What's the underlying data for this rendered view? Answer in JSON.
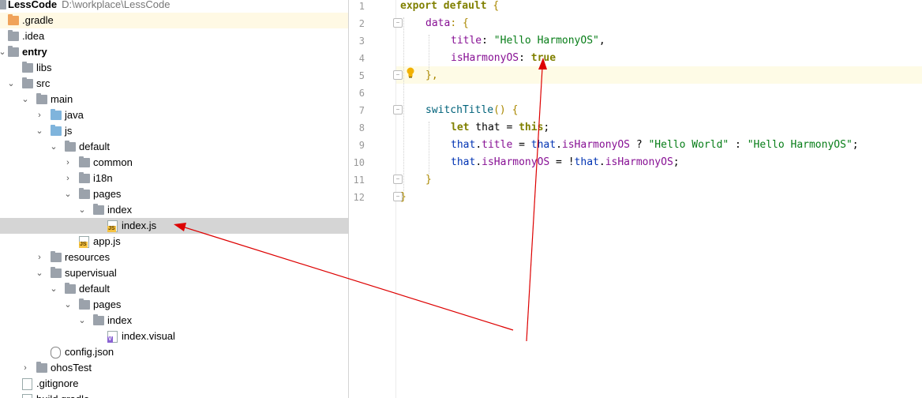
{
  "project": {
    "name": "LessCode",
    "path": "D:\\workplace\\LessCode",
    "items": [
      {
        "label": ".gradle"
      },
      {
        "label": ".idea"
      },
      {
        "label": "entry"
      },
      {
        "label": "libs"
      },
      {
        "label": "src"
      },
      {
        "label": "main"
      },
      {
        "label": "java"
      },
      {
        "label": "js"
      },
      {
        "label": "default"
      },
      {
        "label": "common"
      },
      {
        "label": "i18n"
      },
      {
        "label": "pages"
      },
      {
        "label": "index"
      },
      {
        "label": "index.js"
      },
      {
        "label": "app.js"
      },
      {
        "label": "resources"
      },
      {
        "label": "supervisual"
      },
      {
        "label": "default"
      },
      {
        "label": "pages"
      },
      {
        "label": "index"
      },
      {
        "label": "index.visual"
      },
      {
        "label": "config.json"
      },
      {
        "label": "ohosTest"
      },
      {
        "label": ".gitignore"
      },
      {
        "label": "build.gradle"
      }
    ]
  },
  "editor": {
    "line_numbers": [
      "1",
      "2",
      "3",
      "4",
      "5",
      "6",
      "7",
      "8",
      "9",
      "10",
      "11",
      "12"
    ],
    "code": {
      "l1_kw": "export default",
      "l1_brace": " {",
      "l2_prop": "data",
      "l2_rest": ": {",
      "l3_prop": "title",
      "l3_colon": ": ",
      "l3_str": "\"Hello HarmonyOS\"",
      "l3_comma": ",",
      "l4_prop": "isHarmonyOS",
      "l4_colon": ": ",
      "l4_val": "true",
      "l5": "},",
      "l7_fn": "switchTitle",
      "l7_rest": "() {",
      "l8_kw": "let",
      "l8_var": " that = ",
      "l8_this": "this",
      "l8_end": ";",
      "l9_a": "that",
      "l9_b": ".",
      "l9_c": "title",
      "l9_d": " = ",
      "l9_e": "that",
      "l9_f": ".",
      "l9_g": "isHarmonyOS",
      "l9_h": " ? ",
      "l9_i": "\"Hello World\"",
      "l9_j": " : ",
      "l9_k": "\"Hello HarmonyOS\"",
      "l9_l": ";",
      "l10_a": "that",
      "l10_b": ".",
      "l10_c": "isHarmonyOS",
      "l10_d": " = !",
      "l10_e": "that",
      "l10_f": ".",
      "l10_g": "isHarmonyOS",
      "l10_h": ";",
      "l11": "}",
      "l12": "}"
    }
  },
  "colors": {
    "arrow": "#dd0000",
    "selected_row": "#d5d5d5",
    "current_line": "#fefbe6"
  },
  "icons": [
    "folder-icon",
    "js-file-icon",
    "visual-file-icon",
    "json-file-icon",
    "git-file-icon",
    "gradle-file-icon",
    "lightbulb-icon",
    "chevron-icon"
  ]
}
